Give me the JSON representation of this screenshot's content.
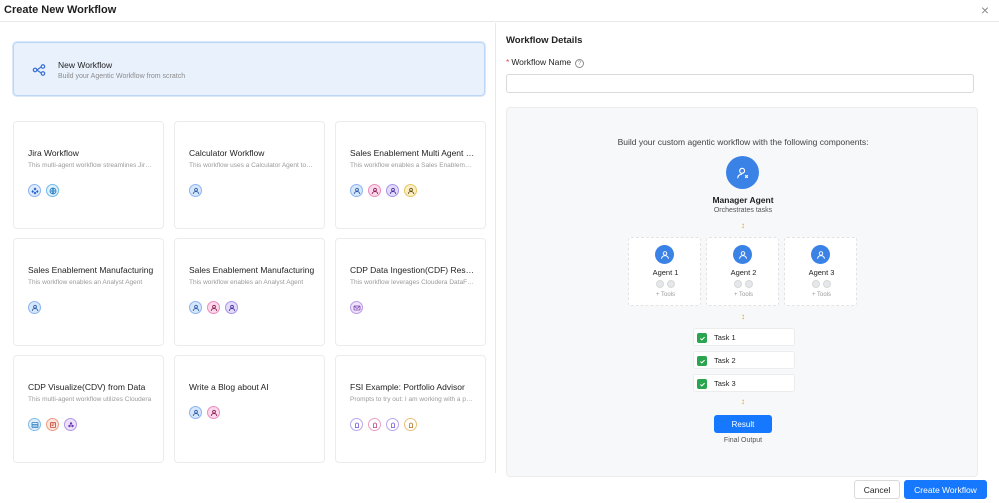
{
  "modal": {
    "title": "Create New Workflow",
    "close_label": "×"
  },
  "new_workflow": {
    "title": "New Workflow",
    "subtitle": "Build your Agentic Workflow from scratch",
    "icon": "workflow-icon"
  },
  "templates": [
    {
      "title": "Jira Workflow",
      "desc": "This multi-agent workflow streamlines Jira operations",
      "icons": [
        "jira",
        "globe"
      ]
    },
    {
      "title": "Calculator Workflow",
      "desc": "This workflow uses a Calculator Agent to compute",
      "icons": [
        "blue"
      ]
    },
    {
      "title": "Sales Enablement Multi Agent Workflow",
      "desc": "This workflow enables a Sales Enablement team",
      "icons": [
        "blue",
        "pink",
        "purple",
        "yellow"
      ]
    },
    {
      "title": "Sales Enablement Manufacturing",
      "desc": "This workflow enables an Analyst Agent",
      "icons": [
        "blue"
      ]
    },
    {
      "title": "Sales Enablement Manufacturing",
      "desc": "This workflow enables an Analyst Agent",
      "icons": [
        "blue",
        "pink",
        "purple"
      ]
    },
    {
      "title": "CDP Data Ingestion(CDF) Resource",
      "desc": "This workflow leverages Cloudera DataFlow",
      "icons": [
        "mail"
      ]
    },
    {
      "title": "CDP Visualize(CDV) from Data",
      "desc": "This multi-agent workflow utilizes Cloudera",
      "icons": [
        "sheet",
        "red",
        "grape"
      ]
    },
    {
      "title": "Write a Blog about AI",
      "desc": "",
      "icons": [
        "blue",
        "pink"
      ]
    },
    {
      "title": "FSI Example: Portfolio Advisor",
      "desc": "Prompts to try out: I am working with a portfolio",
      "icons": [
        "outline-purple",
        "outline-pink",
        "outline-purple",
        "outline-orange"
      ]
    }
  ],
  "details": {
    "title": "Workflow Details",
    "required_mark": "*",
    "name_label": "Workflow Name",
    "help_glyph": "?",
    "name_value": "",
    "name_placeholder": ""
  },
  "diagram": {
    "heading": "Build your custom agentic workflow with the following components:",
    "manager": {
      "name": "Manager Agent",
      "desc": "Orchestrates tasks"
    },
    "agents": [
      {
        "name": "Agent 1",
        "tools": "+ Tools"
      },
      {
        "name": "Agent 2",
        "tools": "+ Tools"
      },
      {
        "name": "Agent 3",
        "tools": "+ Tools"
      }
    ],
    "tasks": [
      "Task 1",
      "Task 2",
      "Task 3"
    ],
    "result": {
      "label": "Result",
      "output": "Final Output"
    },
    "connector": "↕"
  },
  "footer": {
    "cancel": "Cancel",
    "create": "Create Workflow"
  },
  "colors": {
    "primary": "#1677ff",
    "selected_bg": "#e8f1fc",
    "agent_blue": "#3a82e6",
    "task_green": "#2aa44f",
    "connector": "#e0a020"
  }
}
